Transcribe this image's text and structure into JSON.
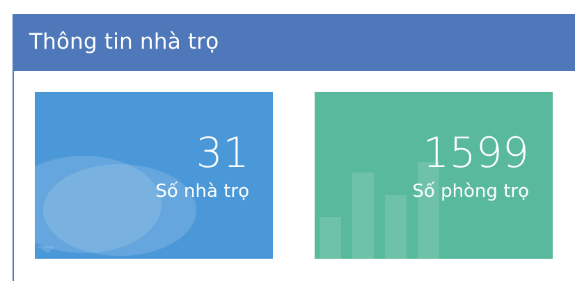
{
  "panel": {
    "title": "Thông tin nhà trọ"
  },
  "stats": [
    {
      "value": "31",
      "label": "Số nhà trọ",
      "icon": "chat-bubbles-icon",
      "color": "#4b98d8"
    },
    {
      "value": "1599",
      "label": "Số phòng trọ",
      "icon": "bar-chart-icon",
      "color": "#58b99c"
    }
  ],
  "colors": {
    "header": "#4f78ba"
  }
}
